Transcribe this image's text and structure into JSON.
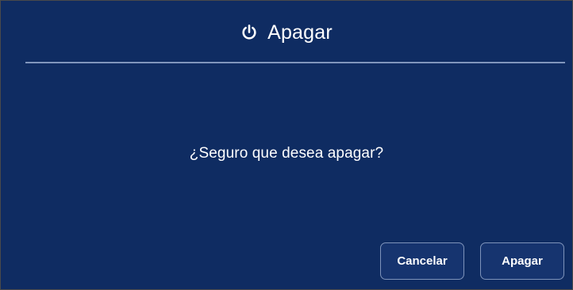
{
  "dialog": {
    "title": "Apagar",
    "title_icon": "power-icon",
    "message": "¿Seguro que desea apagar?",
    "buttons": {
      "cancel_label": "Cancelar",
      "confirm_label": "Apagar"
    },
    "colors": {
      "background": "#0f2c62",
      "button_background": "#16346f",
      "button_border": "#7e93ba",
      "divider": "#8da2c7",
      "text": "#ffffff"
    }
  }
}
